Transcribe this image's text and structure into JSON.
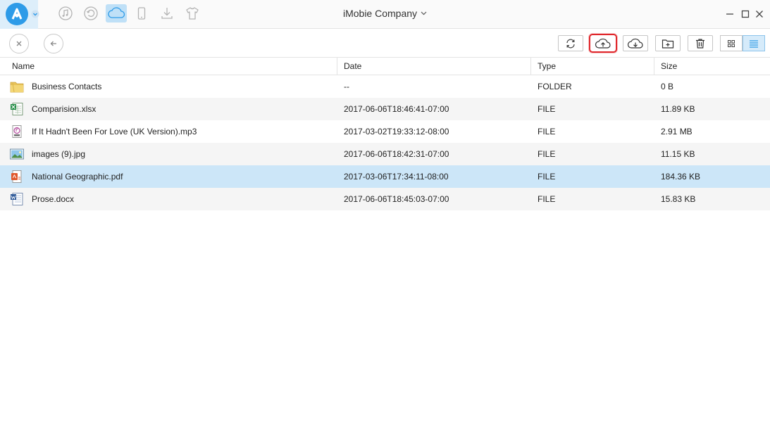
{
  "app": {
    "title": "iMobie Company",
    "nav_icons": [
      "music-icon",
      "history-icon",
      "cloud-icon",
      "device-icon",
      "download-icon",
      "tshirt-icon"
    ],
    "active_nav": "cloud-icon",
    "accent": "#2d9be8"
  },
  "toolbar": {
    "buttons": [
      "refresh-icon",
      "cloud-upload-icon",
      "cloud-download-icon",
      "new-folder-icon",
      "trash-icon"
    ],
    "highlighted": "cloud-upload-icon",
    "highlight_color": "#e0262b",
    "views": [
      "grid-view-icon",
      "list-view-icon"
    ],
    "active_view": "list-view-icon"
  },
  "table": {
    "columns": [
      "Name",
      "Date",
      "Type",
      "Size"
    ],
    "rows": [
      {
        "name": "Business Contacts",
        "date": "--",
        "type": "FOLDER",
        "size": "0 B",
        "icon": "folder-icon"
      },
      {
        "name": "Comparision.xlsx",
        "date": "2017-06-06T18:46:41-07:00",
        "type": "FILE",
        "size": "11.89 KB",
        "icon": "excel-file-icon"
      },
      {
        "name": "If It Hadn't Been For Love (UK Version).mp3",
        "date": "2017-03-02T19:33:12-08:00",
        "type": "FILE",
        "size": "2.91 MB",
        "icon": "audio-file-icon"
      },
      {
        "name": "images (9).jpg",
        "date": "2017-06-06T18:42:31-07:00",
        "type": "FILE",
        "size": "11.15 KB",
        "icon": "image-file-icon"
      },
      {
        "name": "National Geographic.pdf",
        "date": "2017-03-06T17:34:11-08:00",
        "type": "FILE",
        "size": "184.36 KB",
        "icon": "pdf-file-icon"
      },
      {
        "name": "Prose.docx",
        "date": "2017-06-06T18:45:03-07:00",
        "type": "FILE",
        "size": "15.83 KB",
        "icon": "word-file-icon"
      }
    ],
    "selected_row": 4
  }
}
